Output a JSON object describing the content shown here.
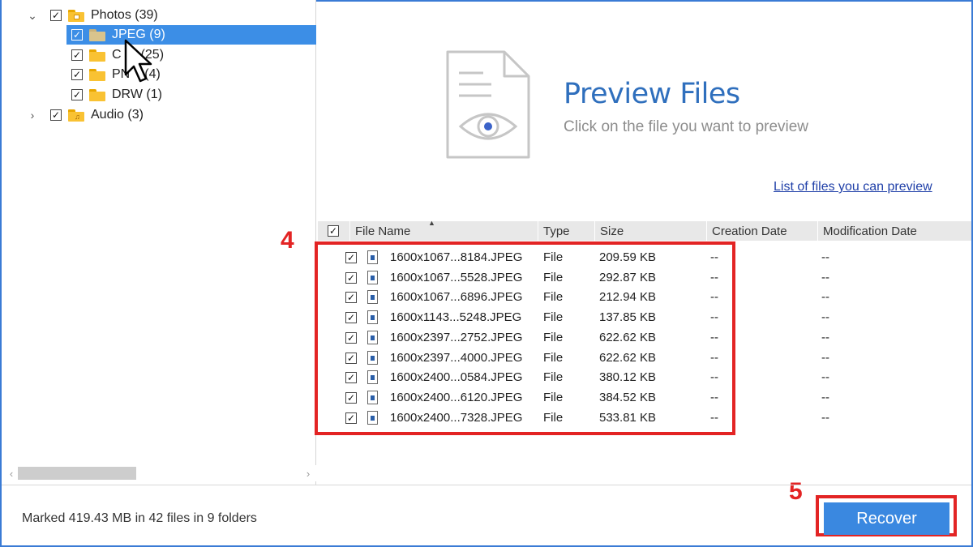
{
  "tree": {
    "items": [
      {
        "label": "Photos (39)",
        "level": 0,
        "expanded": true,
        "checked": true,
        "icon": "photo-folder-icon"
      },
      {
        "label": "JPEG (9)",
        "level": 1,
        "checked": true,
        "selected": true,
        "icon": "folder-icon"
      },
      {
        "label": "C",
        "suffix": "(25)",
        "level": 1,
        "checked": true,
        "icon": "folder-icon"
      },
      {
        "label": "PN",
        "suffix": "(4)",
        "level": 1,
        "checked": true,
        "icon": "folder-icon"
      },
      {
        "label": "DRW (1)",
        "level": 1,
        "checked": true,
        "icon": "folder-icon"
      },
      {
        "label": "Audio (3)",
        "level": 0,
        "expanded": false,
        "checked": true,
        "icon": "audio-folder-icon"
      }
    ]
  },
  "preview": {
    "title": "Preview Files",
    "subtitle": "Click on the file you want to preview",
    "link": "List of files you can preview"
  },
  "table": {
    "columns": [
      "File Name",
      "Type",
      "Size",
      "Creation Date",
      "Modification Date"
    ],
    "rows": [
      {
        "name": "1600x1067...8184.JPEG",
        "type": "File",
        "size": "209.59 KB",
        "created": "--",
        "modified": "--"
      },
      {
        "name": "1600x1067...5528.JPEG",
        "type": "File",
        "size": "292.87 KB",
        "created": "--",
        "modified": "--"
      },
      {
        "name": "1600x1067...6896.JPEG",
        "type": "File",
        "size": "212.94 KB",
        "created": "--",
        "modified": "--"
      },
      {
        "name": "1600x1143...5248.JPEG",
        "type": "File",
        "size": "137.85 KB",
        "created": "--",
        "modified": "--"
      },
      {
        "name": "1600x2397...2752.JPEG",
        "type": "File",
        "size": "622.62 KB",
        "created": "--",
        "modified": "--"
      },
      {
        "name": "1600x2397...4000.JPEG",
        "type": "File",
        "size": "622.62 KB",
        "created": "--",
        "modified": "--"
      },
      {
        "name": "1600x2400...0584.JPEG",
        "type": "File",
        "size": "380.12 KB",
        "created": "--",
        "modified": "--"
      },
      {
        "name": "1600x2400...6120.JPEG",
        "type": "File",
        "size": "384.52 KB",
        "created": "--",
        "modified": "--"
      },
      {
        "name": "1600x2400...7328.JPEG",
        "type": "File",
        "size": "533.81 KB",
        "created": "--",
        "modified": "--"
      }
    ]
  },
  "annotations": {
    "step4": "4",
    "step5": "5",
    "color": "#e32424"
  },
  "status": "Marked 419.43 MB in 42 files in 9 folders",
  "recover_label": "Recover",
  "colors": {
    "accent": "#3a88e0",
    "selection": "#3c8ee6",
    "link": "#1f3fa8",
    "title": "#2f6fbd"
  }
}
